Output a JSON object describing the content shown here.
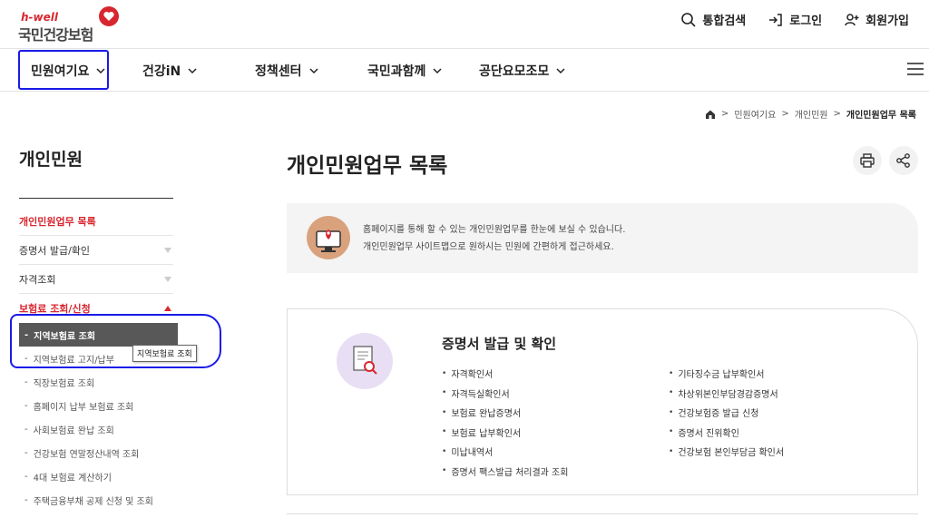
{
  "header": {
    "logo_en": "h-well",
    "logo_kr": "국민건강보험",
    "util": [
      {
        "label": "통합검색",
        "icon": "search-icon"
      },
      {
        "label": "로그인",
        "icon": "login-icon"
      },
      {
        "label": "회원가입",
        "icon": "user-add-icon"
      }
    ]
  },
  "gnb": {
    "items": [
      "민원여기요",
      "건강iN",
      "정책센터",
      "국민과함께",
      "공단요모조모"
    ]
  },
  "breadcrumb": {
    "items": [
      "민원여기요",
      "개인민원"
    ],
    "current": "개인민원업무 목록"
  },
  "sidebar": {
    "title": "개인민원",
    "items": [
      {
        "label": "개인민원업무 목록"
      },
      {
        "label": "증명서 발급/확인"
      },
      {
        "label": "자격조회"
      },
      {
        "label": "보험료 조회/신청"
      }
    ],
    "subitems": [
      "지역보험료 조회",
      "지역보험료 고지/납부",
      "직장보험료 조회",
      "홈페이지 납부 보험료 조회",
      "사회보험료 완납 조회",
      "건강보험 연말정산내역 조회",
      "4대 보험료 계산하기",
      "주택금융부채 공제 신청 및 조회"
    ],
    "tooltip": "지역보험료 조회"
  },
  "main": {
    "title": "개인민원업무 목록",
    "intro_line1": "홈페이지를 통해 할 수 있는 개인민원업무를 한눈에 보실 수 있습니다.",
    "intro_line2": "개인민원업무 사이트맵으로 원하시는 민원에 간편하게 접근하세요.",
    "card": {
      "title": "증명서 발급 및 확인",
      "left": [
        "자격확인서",
        "자격득실확인서",
        "보험료 완납증명서",
        "보험료 납부확인서",
        "미납내역서",
        "증명서 팩스발급 처리결과 조회"
      ],
      "right": [
        "기타징수금 납부확인서",
        "차상위본인부담경감증명서",
        "건강보험증 발급 신청",
        "증명서 진위확인",
        "건강보험 본인부담금 확인서"
      ]
    }
  },
  "colors": {
    "accent": "#d8262e",
    "highlight": "#1a1ae8",
    "selected_bg": "#585858"
  }
}
